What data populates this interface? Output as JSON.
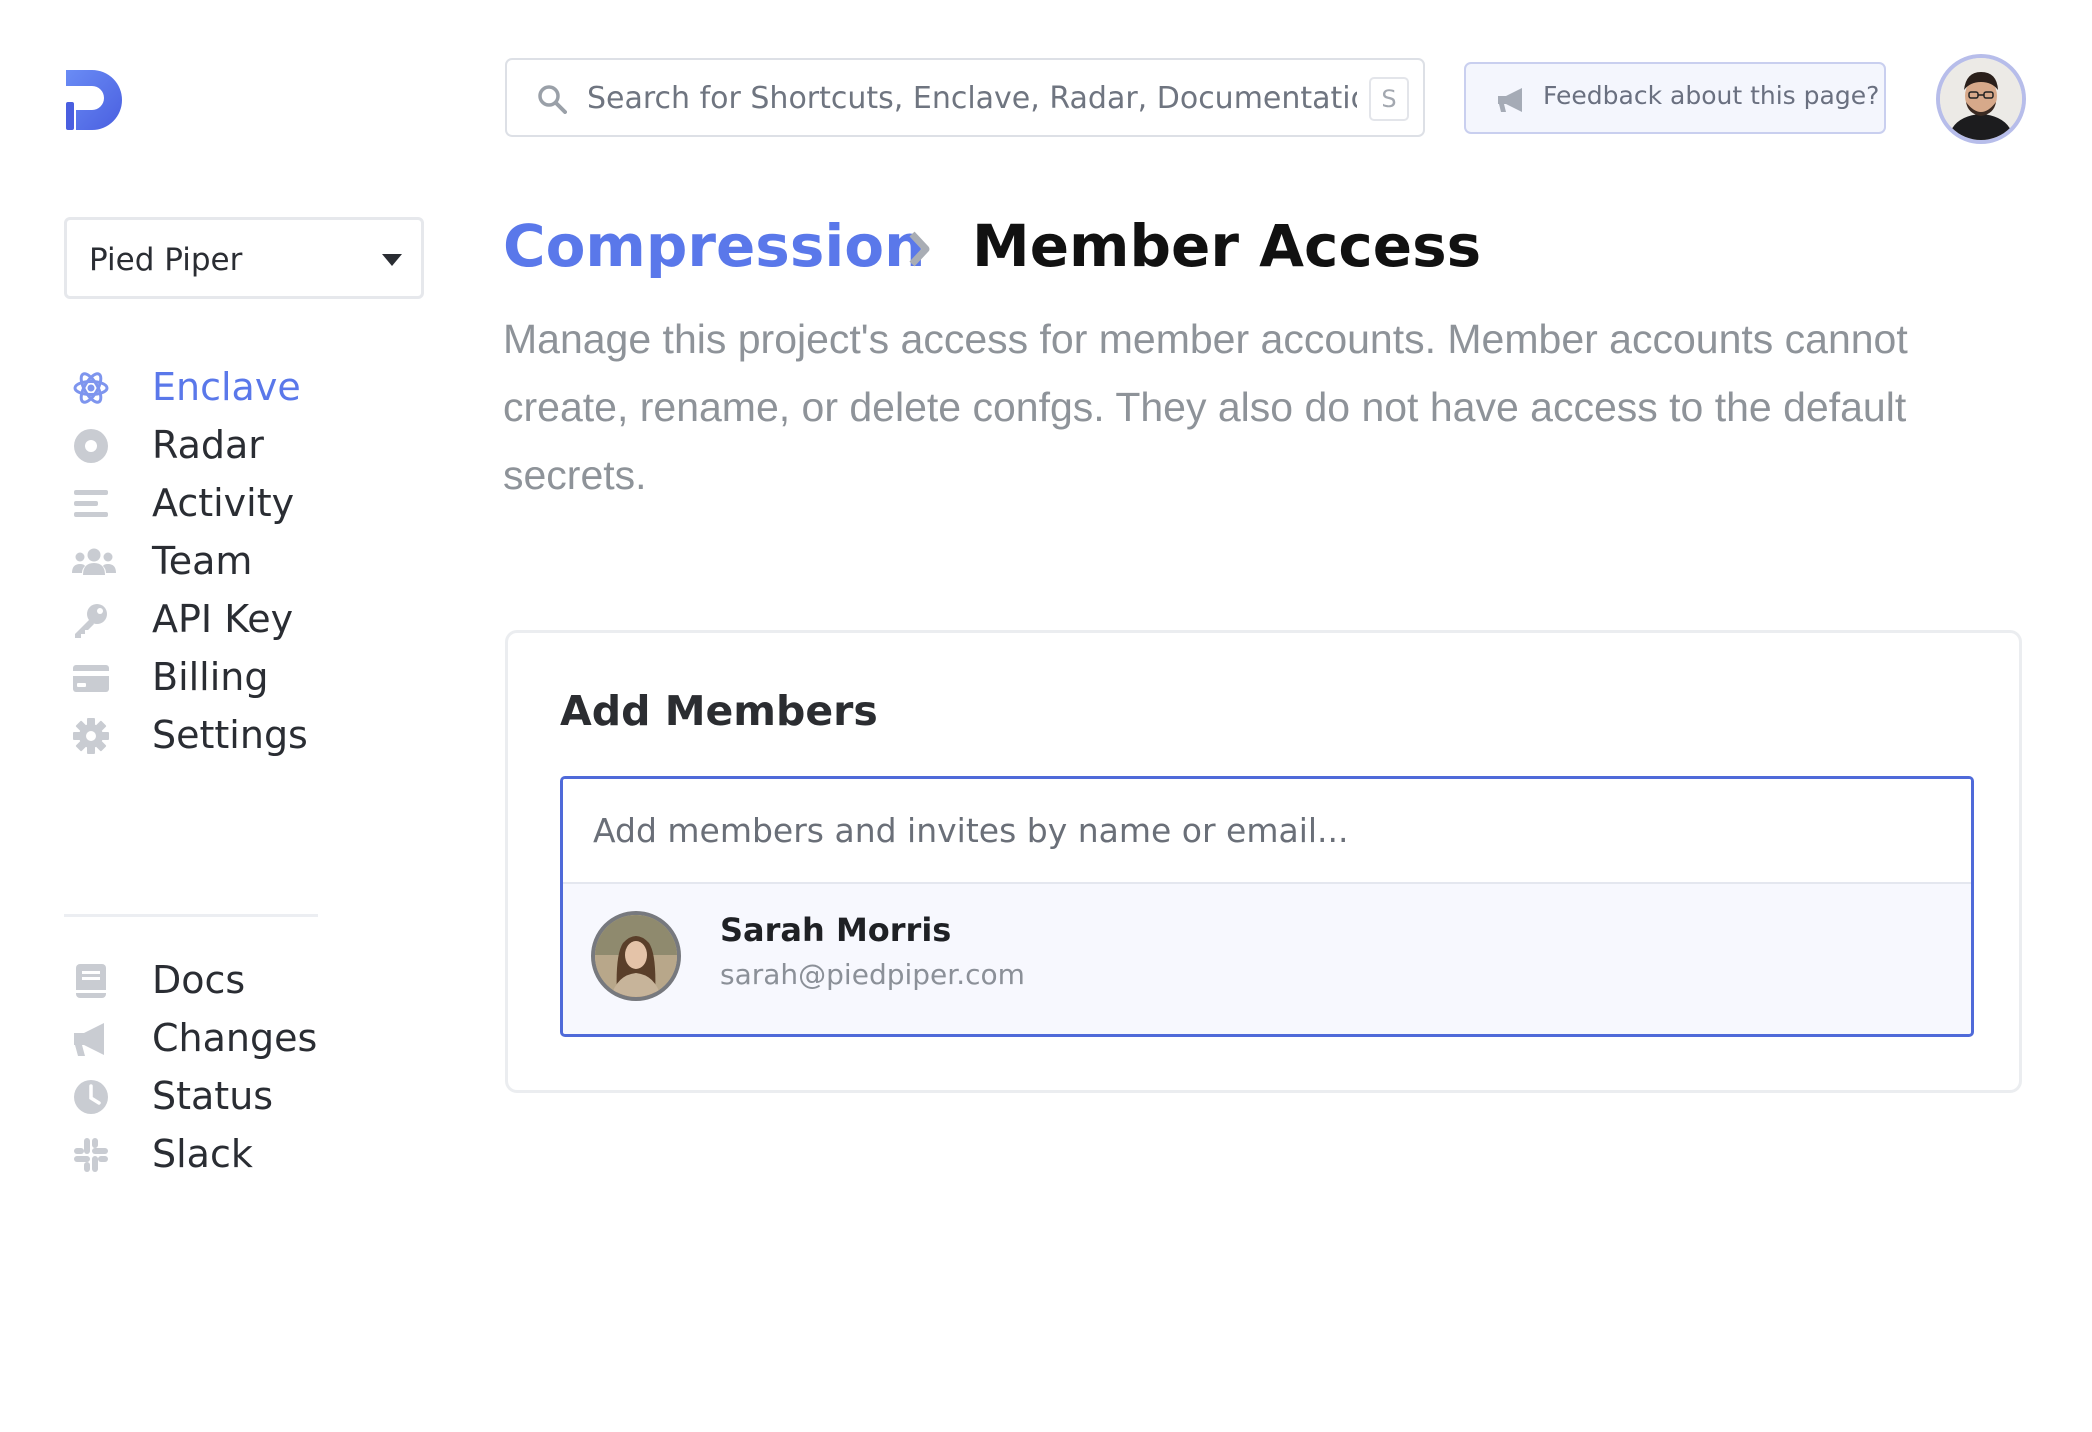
{
  "brand": {
    "accent": "#5a78ea",
    "logo_icon": "doppler-logo-icon"
  },
  "search": {
    "placeholder": "Search for Shortcuts, Enclave, Radar, Documentation...",
    "shortcut_key": "S"
  },
  "feedback": {
    "label": "Feedback about this page?"
  },
  "workspace": {
    "name": "Pied Piper"
  },
  "sidebar": {
    "primary": [
      {
        "label": "Enclave",
        "icon": "atom-icon",
        "active": true
      },
      {
        "label": "Radar",
        "icon": "radar-icon"
      },
      {
        "label": "Activity",
        "icon": "activity-icon"
      },
      {
        "label": "Team",
        "icon": "team-icon"
      },
      {
        "label": "API Key",
        "icon": "key-icon"
      },
      {
        "label": "Billing",
        "icon": "credit-card-icon"
      },
      {
        "label": "Settings",
        "icon": "gear-icon"
      }
    ],
    "secondary": [
      {
        "label": "Docs",
        "icon": "book-icon"
      },
      {
        "label": "Changes",
        "icon": "megaphone-icon"
      },
      {
        "label": "Status",
        "icon": "clock-icon"
      },
      {
        "label": "Slack",
        "icon": "slack-icon"
      }
    ]
  },
  "breadcrumb": {
    "parent": "Compression",
    "current": "Member Access"
  },
  "description": "Manage this project's access for member accounts. Member accounts cannot create, rename, or delete confgs. They also do not have access to the default secrets.",
  "add_members": {
    "title": "Add Members",
    "placeholder": "Add members and invites by name or email...",
    "results": [
      {
        "name": "Sarah Morris",
        "email": "sarah@piedpiper.com"
      }
    ]
  }
}
